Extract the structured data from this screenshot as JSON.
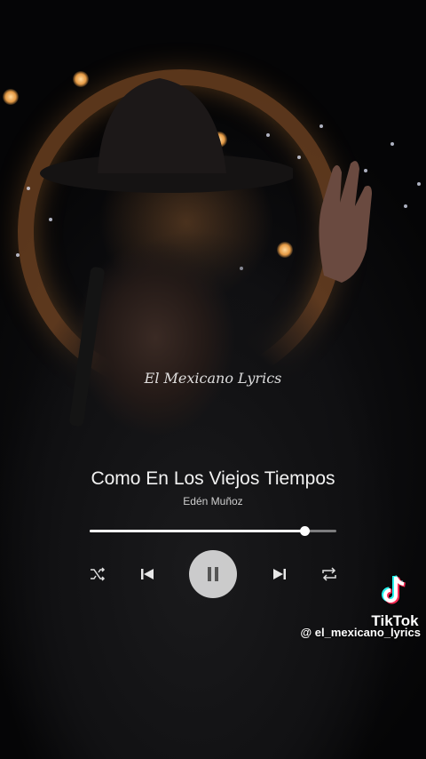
{
  "overlay": {
    "watermark_script": "El Mexicano Lyrics"
  },
  "player": {
    "title": "Como En Los Viejos Tiempos",
    "artist": "Edén Muñoz",
    "progress_fraction": 0.87,
    "state": "playing",
    "controls": {
      "shuffle_icon": "shuffle-icon",
      "previous_icon": "skip-previous-icon",
      "pause_icon": "pause-icon",
      "next_icon": "skip-next-icon",
      "repeat_icon": "repeat-icon"
    }
  },
  "branding": {
    "platform": "TikTok",
    "handle": "@ el_mexicano_lyrics",
    "logo_icon": "tiktok-logo-icon",
    "accent_cyan": "#25f4ee",
    "accent_pink": "#fe2c55"
  },
  "colors": {
    "text_primary": "#f2f2f2",
    "text_secondary": "#cfcfcf",
    "play_button": "#ebebeb"
  }
}
